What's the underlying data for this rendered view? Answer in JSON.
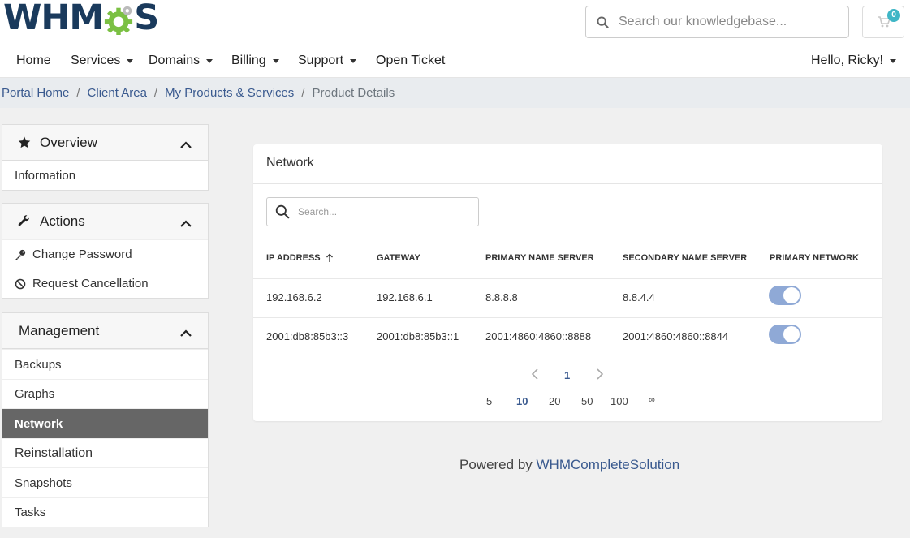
{
  "logo": {
    "left": "WHM",
    "right": "S"
  },
  "header": {
    "search_placeholder": "Search our knowledgebase...",
    "cart_count": "0"
  },
  "nav": {
    "home": "Home",
    "services": "Services",
    "domains": "Domains",
    "billing": "Billing",
    "support": "Support",
    "open_ticket": "Open Ticket",
    "user": "Hello, Ricky!"
  },
  "breadcrumb": {
    "portal_home": "Portal Home",
    "client_area": "Client Area",
    "products": "My Products & Services",
    "current": "Product Details",
    "sep": "/"
  },
  "sidebar": {
    "overview": {
      "title": "Overview",
      "items": [
        "Information"
      ]
    },
    "actions": {
      "title": "Actions",
      "items": [
        "Change Password",
        "Request Cancellation"
      ]
    },
    "management": {
      "title": "Management",
      "items": [
        "Backups",
        "Graphs",
        "Network",
        "Reinstallation",
        "Snapshots",
        "Tasks"
      ],
      "active": "Network"
    }
  },
  "network": {
    "title": "Network",
    "search_placeholder": "Search...",
    "columns": [
      "IP ADDRESS",
      "GATEWAY",
      "PRIMARY NAME SERVER",
      "SECONDARY NAME SERVER",
      "PRIMARY NETWORK"
    ],
    "rows": [
      {
        "ip": "192.168.6.2",
        "gateway": "192.168.6.1",
        "ns1": "8.8.8.8",
        "ns2": "8.8.4.4",
        "primary": true
      },
      {
        "ip": "2001:db8:85b3::3",
        "gateway": "2001:db8:85b3::1",
        "ns1": "2001:4860:4860::8888",
        "ns2": "2001:4860:4860::8844",
        "primary": true
      }
    ],
    "page": "1",
    "page_sizes": [
      "5",
      "10",
      "20",
      "50",
      "100",
      "∞"
    ],
    "active_page_size": "10"
  },
  "footer": {
    "prefix": "Powered by",
    "link": "WHMCompleteSolution"
  },
  "colors": {
    "accent": "#3a5a8f",
    "toggle": "#8fa9d6",
    "badge": "#3fb6c6",
    "active_item": "#666666"
  }
}
